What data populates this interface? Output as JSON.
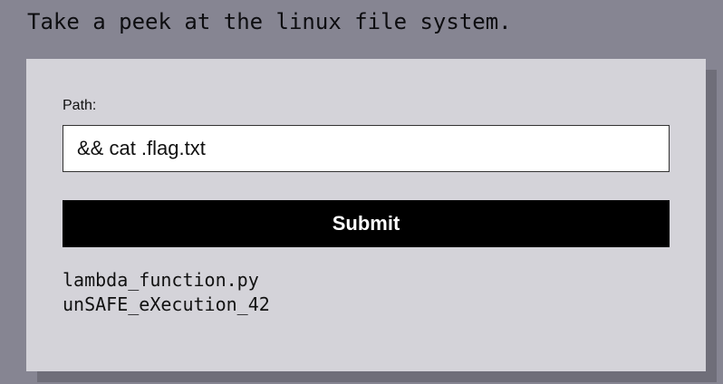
{
  "heading": "Take a peek at the linux file system.",
  "form": {
    "path_label": "Path:",
    "path_value": "&& cat .flag.txt",
    "submit_label": "Submit"
  },
  "output": {
    "lines": [
      "lambda_function.py",
      "unSAFE_eXecution_42"
    ]
  }
}
